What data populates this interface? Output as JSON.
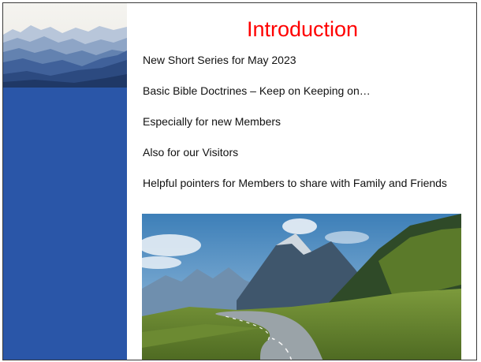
{
  "slide": {
    "title": "Introduction",
    "bullets": [
      "New Short Series for May 2023",
      "Basic Bible Doctrines – Keep on Keeping on…",
      "Especially for new Members",
      "Also for our Visitors",
      "Helpful pointers for Members to share with Family and Friends"
    ]
  },
  "colors": {
    "title": "#ff0000",
    "sidebar": "#2a56a8",
    "text": "#111111"
  }
}
